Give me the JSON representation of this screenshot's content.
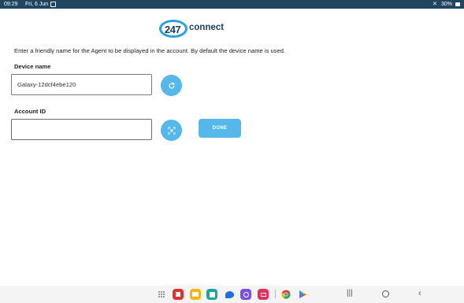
{
  "status_bar": {
    "time": "09:29",
    "date": "Fri, 6 Jun",
    "battery": "30%",
    "icons": [
      "notification-icon",
      "mute-icon",
      "battery-icon"
    ]
  },
  "logo": {
    "number": "247",
    "word": "connect",
    "colors": {
      "ring": "#2b9fd8",
      "text": "#1b3d5e"
    }
  },
  "intro_text": "Enter a friendly name for the Agent to be displayed in the account. By default the device name is used.",
  "device": {
    "label": "Device name",
    "value": "Galaxy-12dcf4ebe120",
    "refresh_icon": "refresh-icon"
  },
  "account": {
    "label": "Account ID",
    "value": "",
    "scan_icon": "qr-scan-icon"
  },
  "done_label": "DONE",
  "accent_color": "#55b7ea",
  "dock": {
    "apps": [
      "apps-grid-icon",
      "flipboard-icon",
      "files-icon",
      "calendar-icon",
      "messages-icon",
      "galaxy-app-icon",
      "screen-recorder-icon",
      "chrome-icon",
      "play-store-icon"
    ],
    "nav": [
      "recents-icon",
      "home-icon",
      "back-icon"
    ]
  }
}
